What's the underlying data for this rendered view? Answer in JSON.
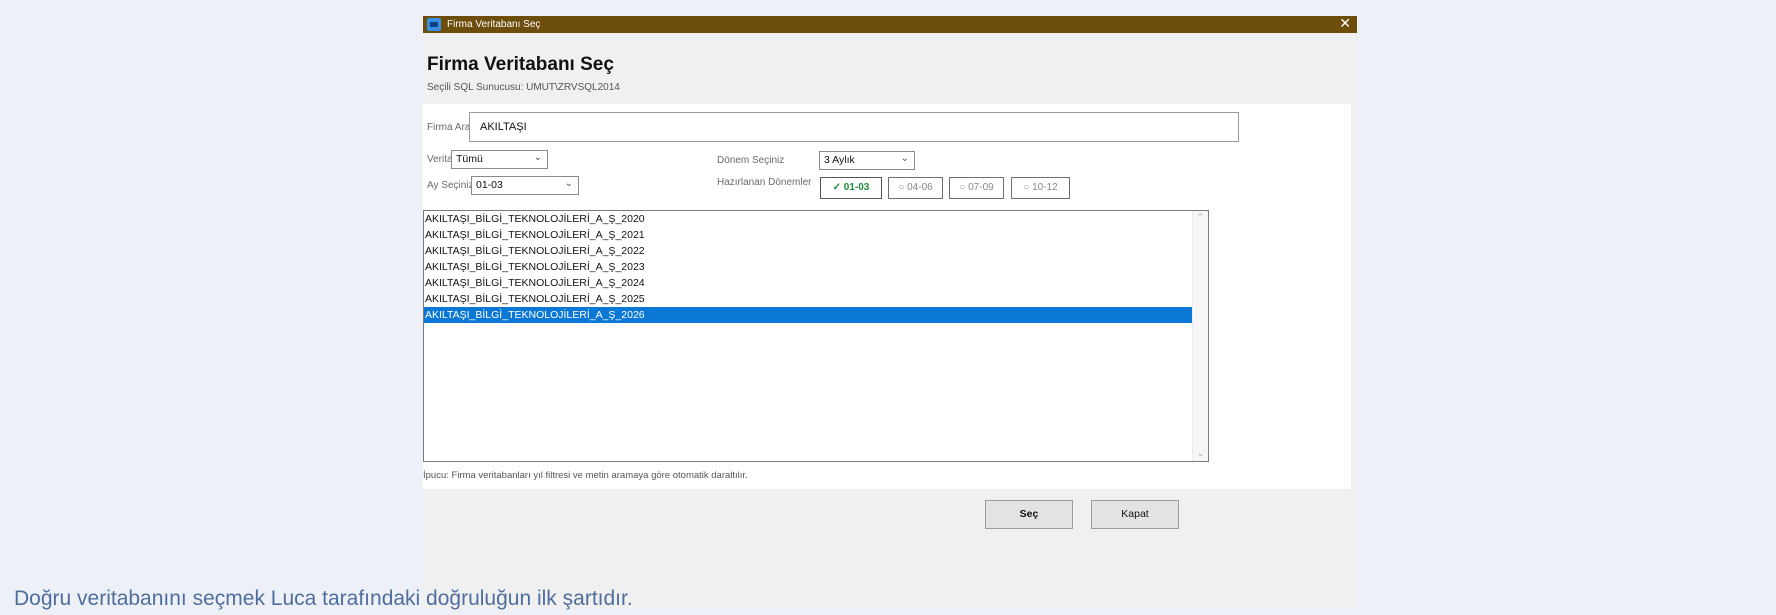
{
  "window": {
    "titlebar_text": "Firma Veritabanı Seç",
    "close_glyph": "✕",
    "heading": "Firma Veritabanı Seç",
    "server_info": "Seçili SQL Sunucusu: UMUT\\ZRVSQL2014"
  },
  "filters": {
    "search_label": "Firma Ara",
    "search_value": "AKILTAŞI",
    "year_label": "Veritabanı Yılı",
    "year_value": "Tümü",
    "month_label": "Ay Seçiniz",
    "month_value": "01-03",
    "period_label": "Dönem Seçiniz",
    "period_value": "3 Aylık",
    "prepared_label": "Hazırlanan Dönemler"
  },
  "periods": [
    {
      "label": "✓ 01-03",
      "active": true
    },
    {
      "label": "○ 04-06",
      "active": false
    },
    {
      "label": "○ 07-09",
      "active": false
    },
    {
      "label": "○ 10-12",
      "active": false
    }
  ],
  "databases": [
    "AKILTAŞI_BİLGİ_TEKNOLOJİLERİ_A_Ş_2020",
    "AKILTAŞI_BİLGİ_TEKNOLOJİLERİ_A_Ş_2021",
    "AKILTAŞI_BİLGİ_TEKNOLOJİLERİ_A_Ş_2022",
    "AKILTAŞI_BİLGİ_TEKNOLOJİLERİ_A_Ş_2023",
    "AKILTAŞI_BİLGİ_TEKNOLOJİLERİ_A_Ş_2024",
    "AKILTAŞI_BİLGİ_TEKNOLOJİLERİ_A_Ş_2025",
    "AKILTAŞI_BİLGİ_TEKNOLOJİLERİ_A_Ş_2026"
  ],
  "selected_database_index": 6,
  "hint": "İpucu: Firma veritabanları yıl filtresi ve metin aramaya göre otomatik daraltılır.",
  "buttons": {
    "select": "Seç",
    "close": "Kapat"
  },
  "caption": "Doğru veritabanını seçmek Luca tarafındaki doğruluğun ilk şartıdır.",
  "colors": {
    "titlebar": "#6c4d0b",
    "selection": "#0a78d4",
    "active_period": "#1d8c3a",
    "caption": "#4f6e9e"
  }
}
